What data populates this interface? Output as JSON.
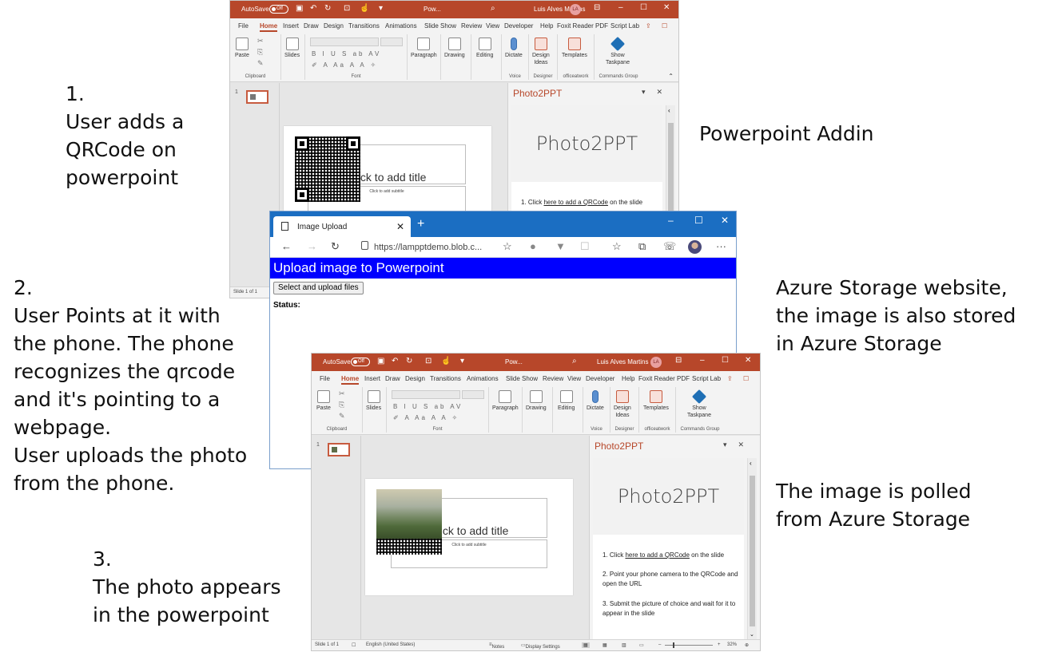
{
  "captions": {
    "step1": "1.\nUser adds a\nQRCode on\npowerpoint",
    "step2": "2.\nUser Points at it with\nthe phone. The phone\nrecognizes the qrcode\nand it's pointing to a\nwebpage.\nUser uploads the photo\nfrom the phone.",
    "step3": "3.\nThe photo appears\nin the powerpoint",
    "addin": "Powerpoint Addin",
    "azure": "Azure Storage website,\nthe image is also stored\nin Azure Storage",
    "polled": "The image is polled\nfrom Azure Storage"
  },
  "ppt_top": {
    "titlebar": {
      "autosave": "AutoSave",
      "autosave_state": "Off",
      "doc": "Pow...",
      "user": "Luis Alves Martins",
      "initials": "LA"
    },
    "tabs": [
      "File",
      "Home",
      "Insert",
      "Draw",
      "Design",
      "Transitions",
      "Animations",
      "Slide Show",
      "Review",
      "View",
      "Developer",
      "Help",
      "Foxit Reader PDF",
      "Script Lab"
    ],
    "ribbon": {
      "paste": "Paste",
      "clipboard": "Clipboard",
      "slides": "Slides",
      "font": "Font",
      "paragraph": "Paragraph",
      "drawing": "Drawing",
      "editing": "Editing",
      "dictate": "Dictate",
      "voice": "Voice",
      "design_ideas": "Design\nIdeas",
      "designer": "Designer",
      "templates": "Templates",
      "officeatwork": "officeatwork",
      "show_taskpane": "Show\nTaskpane",
      "commands_group": "Commands Group"
    },
    "slide_number": "1",
    "title_placeholder": "Click to add title",
    "subtitle_placeholder": "Click to add subtitle",
    "taskpane": {
      "title": "Photo2PPT",
      "heading": "Photo2PPT",
      "step1_prefix": "1. Click ",
      "step1_link": "here to add a QRCode",
      "step1_suffix": " on the slide"
    },
    "status": "Slide 1 of 1"
  },
  "browser": {
    "tab_title": "Image Upload",
    "url": "https://lampptdemo.blob.c...",
    "banner": "Upload image to Powerpoint",
    "upload_button": "Select and upload files",
    "status_label": "Status:"
  },
  "ppt_bottom": {
    "titlebar": {
      "autosave": "AutoSave",
      "autosave_state": "Off",
      "doc": "Pow...",
      "user": "Luis Alves Martins",
      "initials": "LA"
    },
    "tabs": [
      "File",
      "Home",
      "Insert",
      "Draw",
      "Design",
      "Transitions",
      "Animations",
      "Slide Show",
      "Review",
      "View",
      "Developer",
      "Help",
      "Foxit Reader PDF",
      "Script Lab"
    ],
    "ribbon": {
      "paste": "Paste",
      "clipboard": "Clipboard",
      "slides": "Slides",
      "font": "Font",
      "paragraph": "Paragraph",
      "drawing": "Drawing",
      "editing": "Editing",
      "dictate": "Dictate",
      "voice": "Voice",
      "design_ideas": "Design\nIdeas",
      "designer": "Designer",
      "templates": "Templates",
      "officeatwork": "officeatwork",
      "show_taskpane": "Show\nTaskpane",
      "commands_group": "Commands Group"
    },
    "slide_number": "1",
    "title_placeholder": "Click to add title",
    "subtitle_placeholder": "Click to add subtitle",
    "taskpane": {
      "title": "Photo2PPT",
      "heading": "Photo2PPT",
      "step1_prefix": "1. Click ",
      "step1_link": "here to add a QRCode",
      "step1_suffix": " on the slide",
      "step2": "2. Point your phone camera to the QRCode and open the URL",
      "step3": "3. Submit the picture of choice and wait for it to appear in the slide"
    },
    "status": {
      "slide": "Slide 1 of 1",
      "language": "English (United States)",
      "notes": "Notes",
      "display": "Display Settings",
      "zoom": "32%"
    }
  },
  "colors": {
    "ppt_accent": "#b7472a",
    "edge_blue": "#1b6ec2",
    "banner_blue": "#0000ff"
  }
}
